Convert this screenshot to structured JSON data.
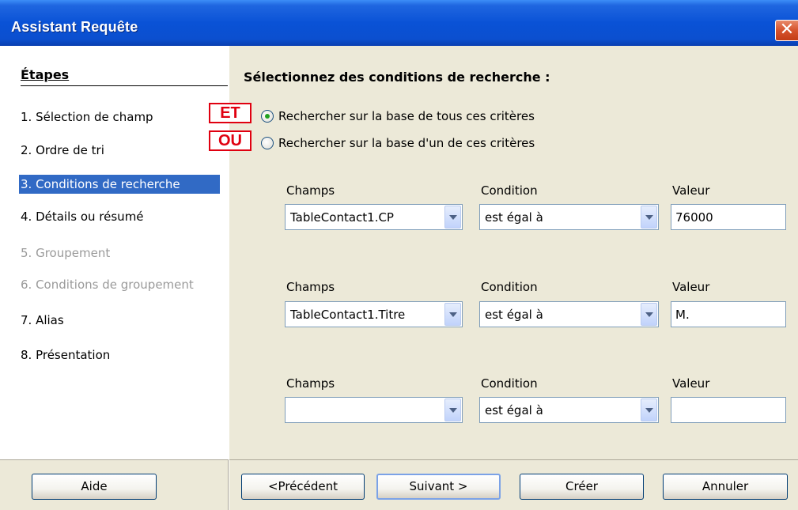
{
  "window": {
    "title": "Assistant Requête",
    "close_label": "✕"
  },
  "sidebar": {
    "title": "Étapes",
    "steps": [
      {
        "label": "1.  Sélection de champ",
        "state": "normal"
      },
      {
        "label": "2.  Ordre de tri",
        "state": "normal"
      },
      {
        "label": "3.  Conditions de recherche",
        "state": "active"
      },
      {
        "label": "4.  Détails ou résumé",
        "state": "normal"
      },
      {
        "label": "5.  Groupement",
        "state": "disabled"
      },
      {
        "label": "6.  Conditions de groupement",
        "state": "disabled"
      },
      {
        "label": "7.  Alias",
        "state": "normal"
      },
      {
        "label": "8.  Présentation",
        "state": "normal"
      }
    ]
  },
  "main": {
    "title": "Sélectionnez des conditions de recherche :",
    "tag_and": "ET",
    "tag_or": "OU",
    "radio_all": {
      "label": "Rechercher sur la base de tous ces critères",
      "selected": true
    },
    "radio_any": {
      "label": "Rechercher sur la base d'un de ces critères",
      "selected": false
    },
    "conditions": [
      {
        "field_label": "Champs",
        "field_value": "TableContact1.CP",
        "cond_label": "Condition",
        "cond_value": "est égal à",
        "value_label": "Valeur",
        "value": "76000"
      },
      {
        "field_label": "Champs",
        "field_value": "TableContact1.Titre",
        "cond_label": "Condition",
        "cond_value": "est égal à",
        "value_label": "Valeur",
        "value": "M."
      },
      {
        "field_label": "Champs",
        "field_value": "",
        "cond_label": "Condition",
        "cond_value": "est égal à",
        "value_label": "Valeur",
        "value": ""
      }
    ]
  },
  "footer": {
    "help": "Aide",
    "previous": "<Précédent",
    "next": "Suivant >",
    "create": "Créer",
    "cancel": "Annuler"
  },
  "colors": {
    "accent": "#316ac5",
    "title_bar": "#0a52d6",
    "tag_red": "#e00010"
  }
}
